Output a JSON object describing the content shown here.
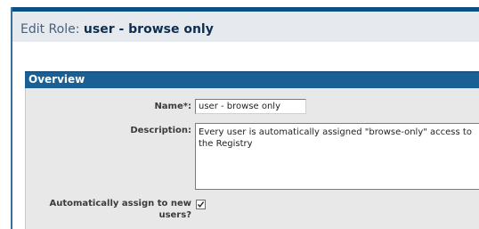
{
  "header": {
    "prefix": "Edit Role:",
    "role_name": "user - browse only"
  },
  "section": {
    "title": "Overview"
  },
  "form": {
    "name_label": "Name*:",
    "name_value": "user - browse only",
    "description_label": "Description:",
    "description_value": "Every user is automatically assigned \"browse-only\" access to the Registry",
    "auto_assign_label": "Automatically assign to new users?",
    "auto_assign_checked": true
  },
  "icons": [
    "checkmark-icon"
  ]
}
